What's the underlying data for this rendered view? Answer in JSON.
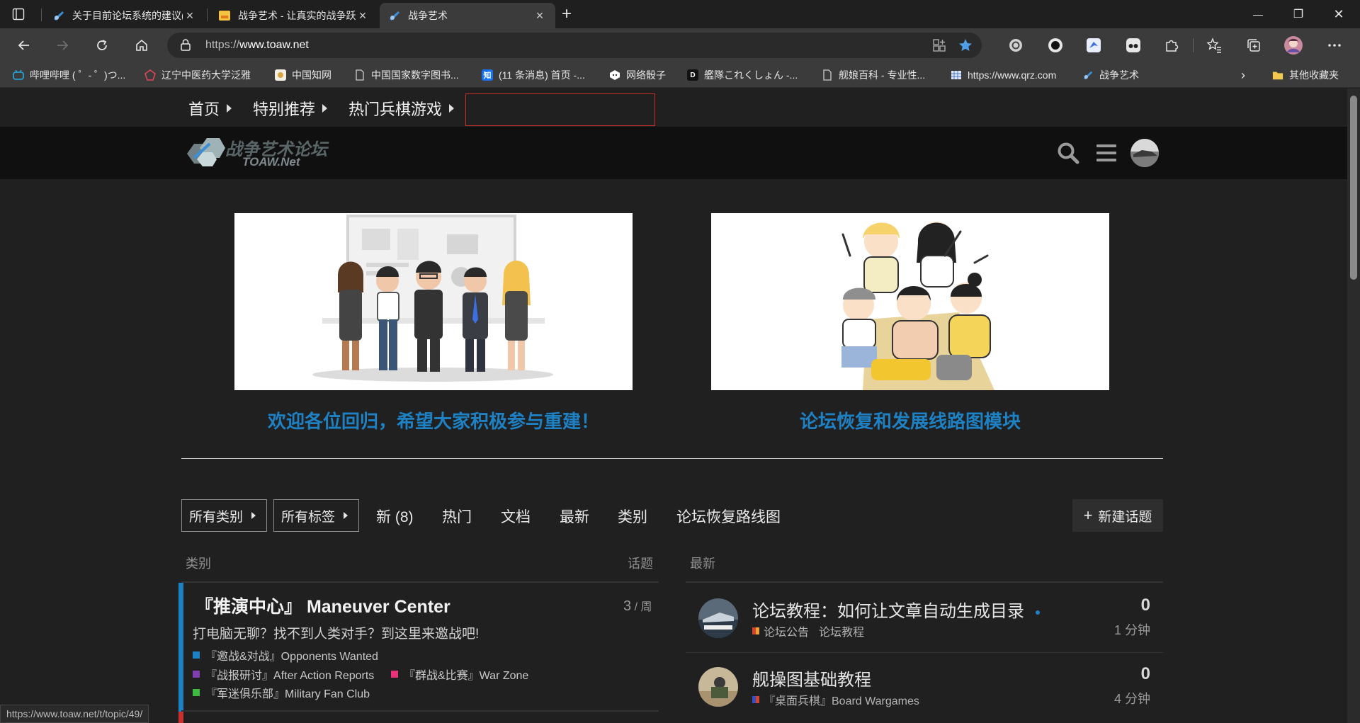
{
  "tabs": [
    {
      "title": "关于目前论坛系统的建议(建议加",
      "icon": "toaw-favicon"
    },
    {
      "title": "战争艺术 - 让真实的战争跃然纸上",
      "icon": "yellow-page-favicon"
    },
    {
      "title": "战争艺术",
      "icon": "toaw-favicon",
      "active": true
    }
  ],
  "window": {
    "minimize": "—",
    "maximize": "❐",
    "close": "✕"
  },
  "address": {
    "scheme": "https://",
    "host": "www.toaw.net"
  },
  "bookmarks": [
    {
      "label": "哔哩哔哩 ( ゜- ゜)つ...",
      "icon": "bilibili-icon",
      "color": "#23ade5"
    },
    {
      "label": "辽宁中医药大学泛雅",
      "icon": "fanya-icon",
      "color": "#e0455a"
    },
    {
      "label": "中国知网",
      "icon": "cnki-icon",
      "color": "#d9a441"
    },
    {
      "label": "中国国家数字图书...",
      "icon": "page-icon",
      "color": "#cccccc"
    },
    {
      "label": "(11 条消息) 首页 -...",
      "icon": "zhihu-icon",
      "color": "#1772f6"
    },
    {
      "label": "网络骰子",
      "icon": "dice-icon",
      "color": "#ffffff"
    },
    {
      "label": "艦隊これくしょん -...",
      "icon": "dmm-icon",
      "color": "#111111"
    },
    {
      "label": "舰娘百科 - 专业性...",
      "icon": "page-icon",
      "color": "#cccccc"
    },
    {
      "label": "https://www.qrz.com",
      "icon": "qrz-icon",
      "color": "#4a78c7"
    },
    {
      "label": "战争艺术",
      "icon": "toaw-favicon",
      "color": "#3c8fd6"
    }
  ],
  "other_bookmarks": "其他收藏夹",
  "topnav": {
    "home": "首页",
    "featured": "特别推荐",
    "hot_games": "热门兵棋游戏"
  },
  "logo": {
    "line1": "战争艺术论坛",
    "line2": "TOAW.Net"
  },
  "banners": [
    {
      "caption": "欢迎各位回归，希望大家积极参与重建！"
    },
    {
      "caption": "论坛恢复和发展线路图模块"
    }
  ],
  "filters": {
    "all_categories": "所有类别",
    "all_tags": "所有标签"
  },
  "nav_tabs": [
    "新 (8)",
    "热门",
    "文档",
    "最新",
    "类别",
    "论坛恢复路线图"
  ],
  "new_topic": "新建话题",
  "columns": {
    "category": "类别",
    "topics": "话题",
    "latest": "最新"
  },
  "category": {
    "title": "『推演中心』 Maneuver Center",
    "count": "3",
    "per": " / 周",
    "description": "打电脑无聊？找不到人类对手？到这里来邀战吧!",
    "color": "#1e81c4",
    "subcategories": [
      {
        "label": "『邀战&对战』Opponents Wanted",
        "color": "#1e81c4"
      },
      {
        "label": "『战报研讨』After Action Reports",
        "color": "#7d3fb0"
      },
      {
        "label": "『群战&比赛』War Zone",
        "color": "#e8337a"
      },
      {
        "label": "『军迷俱乐部』Military Fan Club",
        "color": "#3fba3f"
      }
    ],
    "next_color": "#c9302c"
  },
  "topics": [
    {
      "title": "论坛教程：如何让文章自动生成目录",
      "category": "论坛公告",
      "tag": "论坛教程",
      "replies": "0",
      "ago": "1 分钟",
      "badge": [
        "#d4442c",
        "#e8a23a"
      ],
      "unread": true
    },
    {
      "title": "舰操图基础教程",
      "category": "『桌面兵棋』Board Wargames",
      "tag": "",
      "replies": "0",
      "ago": "4 分钟",
      "badge": [
        "#3050c8",
        "#d4442c"
      ],
      "unread": false
    }
  ],
  "status_url": "https://www.toaw.net/t/topic/49/"
}
